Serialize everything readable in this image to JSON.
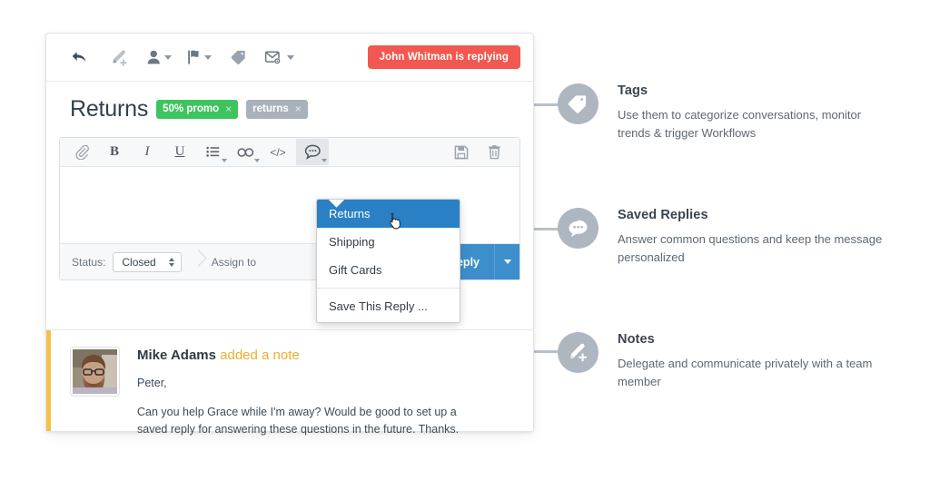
{
  "app": {
    "actionbar": {
      "buttons": [
        {
          "name": "reply-icon",
          "label": "Reply"
        },
        {
          "name": "add-note-icon",
          "label": "Add Note"
        },
        {
          "name": "assign-person-icon",
          "label": "Assign"
        },
        {
          "name": "flag-icon",
          "label": "Flag"
        },
        {
          "name": "tag-icon",
          "label": "Tag"
        },
        {
          "name": "email-settings-icon",
          "label": "Email Options"
        }
      ],
      "replying_badge": "John Whitman is replying"
    },
    "conversation": {
      "title": "Returns",
      "tags": [
        {
          "label": "50% promo",
          "close": "×",
          "color": "#3ec45f"
        },
        {
          "label": "returns",
          "close": "×",
          "color": "#a9b2bb"
        }
      ]
    },
    "editor": {
      "toolbar": [
        {
          "name": "attachment-icon",
          "glyph": "attach"
        },
        {
          "name": "bold-button",
          "glyph": "B"
        },
        {
          "name": "italic-button",
          "glyph": "I"
        },
        {
          "name": "underline-button",
          "glyph": "U"
        },
        {
          "name": "list-button",
          "glyph": "list"
        },
        {
          "name": "link-button",
          "glyph": "link"
        },
        {
          "name": "code-button",
          "glyph": "</>"
        },
        {
          "name": "saved-replies-button",
          "glyph": "bubble"
        }
      ],
      "right_tools": [
        {
          "name": "save-draft-icon",
          "glyph": "floppy"
        },
        {
          "name": "delete-draft-icon",
          "glyph": "trash"
        }
      ],
      "body_text": ""
    },
    "saved_replies_menu": {
      "items": [
        "Returns",
        "Shipping",
        "Gift Cards"
      ],
      "selected": "Returns",
      "footer_item": "Save This Reply ..."
    },
    "footer": {
      "status_label": "Status:",
      "status_value": "Closed",
      "assign_label": "Assign to",
      "send_label": "Send Reply"
    },
    "note": {
      "author": "Mike Adams",
      "action": "added a note",
      "greeting": "Peter,",
      "body": "Can you help Grace while I'm away? Would be good to set up a saved reply for answering these questions in the future. Thanks.",
      "accent_color": "#f4c24a"
    }
  },
  "callouts": [
    {
      "icon": "tag-icon",
      "title": "Tags",
      "desc": "Use them to categorize conversations, monitor trends & trigger Workflows"
    },
    {
      "icon": "speech-bubble-icon",
      "title": "Saved Replies",
      "desc": "Answer common questions and keep the message personalized"
    },
    {
      "icon": "note-pencil-icon",
      "title": "Notes",
      "desc": "Delegate and communicate privately with a team member"
    }
  ]
}
